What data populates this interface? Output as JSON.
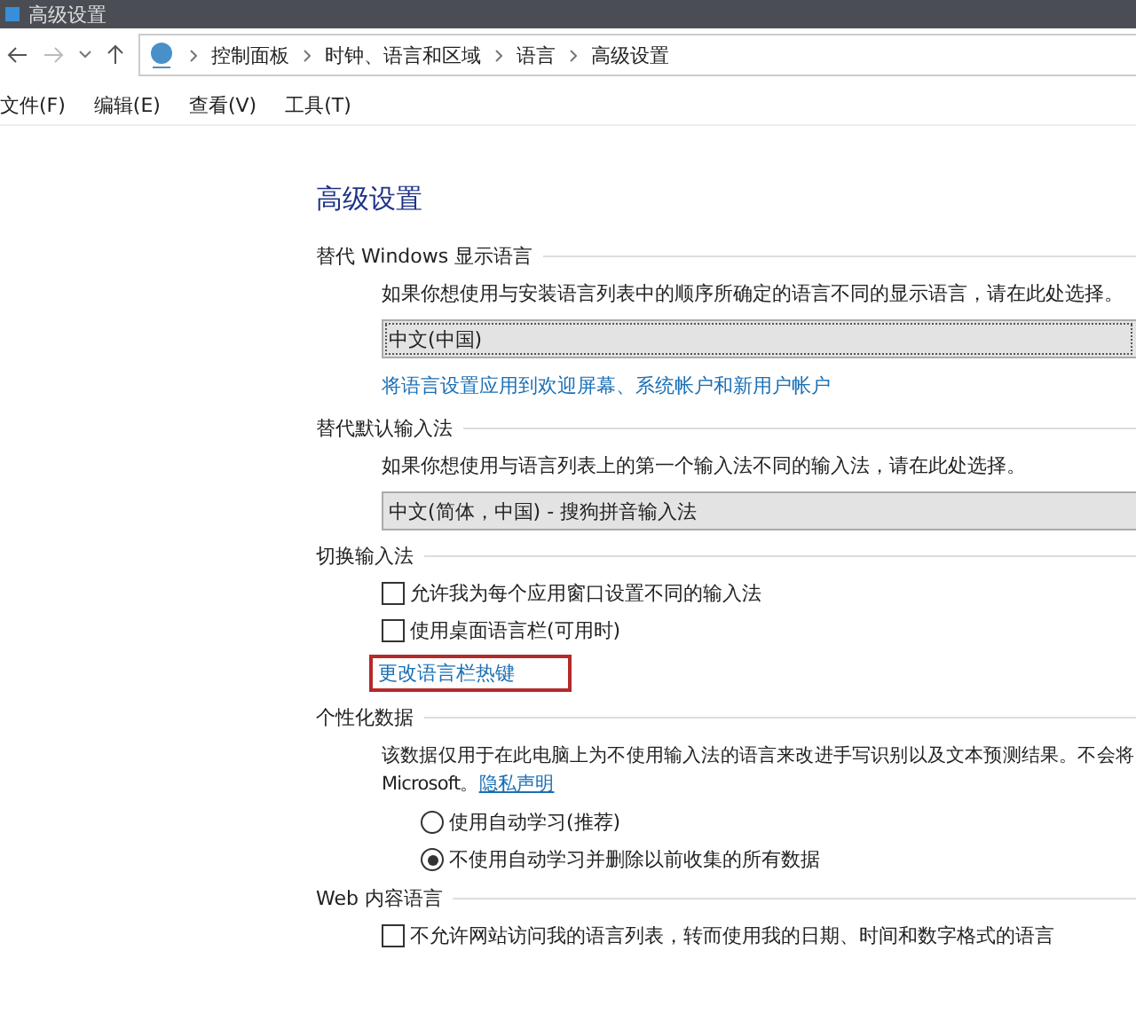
{
  "window": {
    "title": "高级设置"
  },
  "breadcrumb": [
    "控制面板",
    "时钟、语言和区域",
    "语言",
    "高级设置"
  ],
  "menu": [
    "文件(F)",
    "编辑(E)",
    "查看(V)",
    "工具(T)"
  ],
  "heading": "高级设置",
  "sections": [
    {
      "title": "替代 Windows 显示语言",
      "items": [
        {
          "kind": "text",
          "text": "如果你想使用与安装语言列表中的顺序所确定的语言不同的显示语言，请在此处选择。"
        },
        {
          "kind": "dropdown",
          "value": "中文(中国)",
          "focused": true
        },
        {
          "kind": "link",
          "text": "将语言设置应用到欢迎屏幕、系统帐户和新用户帐户",
          "highlighted": false
        }
      ]
    },
    {
      "title": "替代默认输入法",
      "items": [
        {
          "kind": "text",
          "text": "如果你想使用与语言列表上的第一个输入法不同的输入法，请在此处选择。"
        },
        {
          "kind": "dropdown",
          "value": "中文(简体，中国) - 搜狗拼音输入法",
          "focused": false
        }
      ]
    },
    {
      "title": "切换输入法",
      "items": [
        {
          "kind": "checkbox",
          "text": "允许我为每个应用窗口设置不同的输入法",
          "checked": false
        },
        {
          "kind": "checkbox",
          "text": "使用桌面语言栏(可用时)",
          "checked": false
        },
        {
          "kind": "link",
          "text": "更改语言栏热键",
          "highlighted": true
        }
      ]
    },
    {
      "title": "个性化数据",
      "items": [
        {
          "kind": "paragraph",
          "text": "该数据仅用于在此电脑上为不使用输入法的语言来改进手写识别以及文本预测结果。不会将",
          "text2": "Microsoft。",
          "link": "隐私声明"
        },
        {
          "kind": "radio",
          "text": "使用自动学习(推荐)",
          "selected": false
        },
        {
          "kind": "radio",
          "text": "不使用自动学习并删除以前收集的所有数据",
          "selected": true
        }
      ]
    },
    {
      "title": "Web 内容语言",
      "items": [
        {
          "kind": "checkbox",
          "text": "不允许网站访问我的语言列表，转而使用我的日期、时间和数字格式的语言",
          "checked": false
        }
      ]
    }
  ]
}
